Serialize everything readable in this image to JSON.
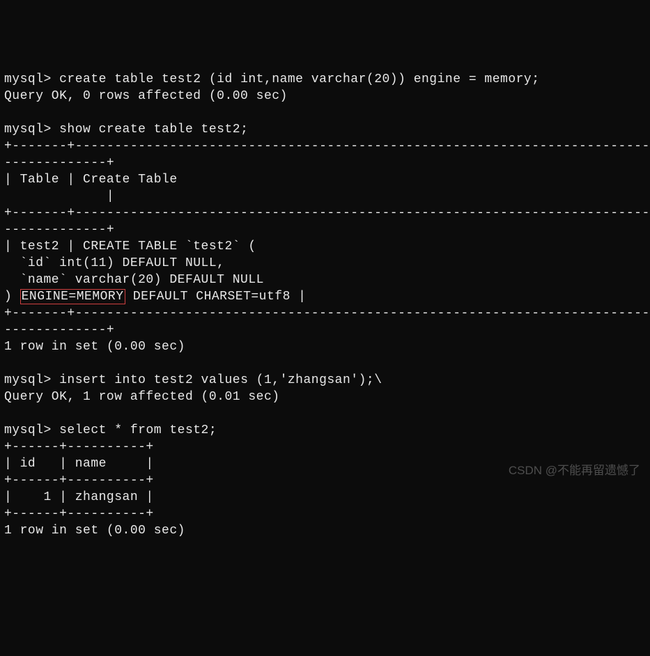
{
  "prompt": "mysql> ",
  "commands": {
    "create_table": "create table test2 (id int,name varchar(20)) engine = memory;",
    "show_create": "show create table test2;",
    "insert": "insert into test2 values (1,'zhangsan');\\",
    "select": "select * from test2;"
  },
  "responses": {
    "query_ok_0": "Query OK, 0 rows affected (0.00 sec)",
    "query_ok_1": "Query OK, 1 row affected (0.01 sec)",
    "one_row": "1 row in set (0.00 sec)"
  },
  "show_create_table": {
    "header_line1": "+-------+---------------------------------------------------------------------------------",
    "header_line2": "-------------+",
    "cols_line1": "| Table | Create Table                                                                    ",
    "cols_line2": "             |",
    "row_table": "| test2 | CREATE TABLE `test2` (",
    "row_id": "  `id` int(11) DEFAULT NULL,",
    "row_name": "  `name` varchar(20) DEFAULT NULL",
    "row_engine_prefix": ") ",
    "row_engine_highlight": "ENGINE=MEMORY",
    "row_engine_suffix": " DEFAULT CHARSET=utf8 |"
  },
  "select_table": {
    "border": "+------+----------+",
    "header": "| id   | name     |",
    "row1": "|    1 | zhangsan |"
  },
  "watermark": "CSDN @不能再留遗憾了"
}
